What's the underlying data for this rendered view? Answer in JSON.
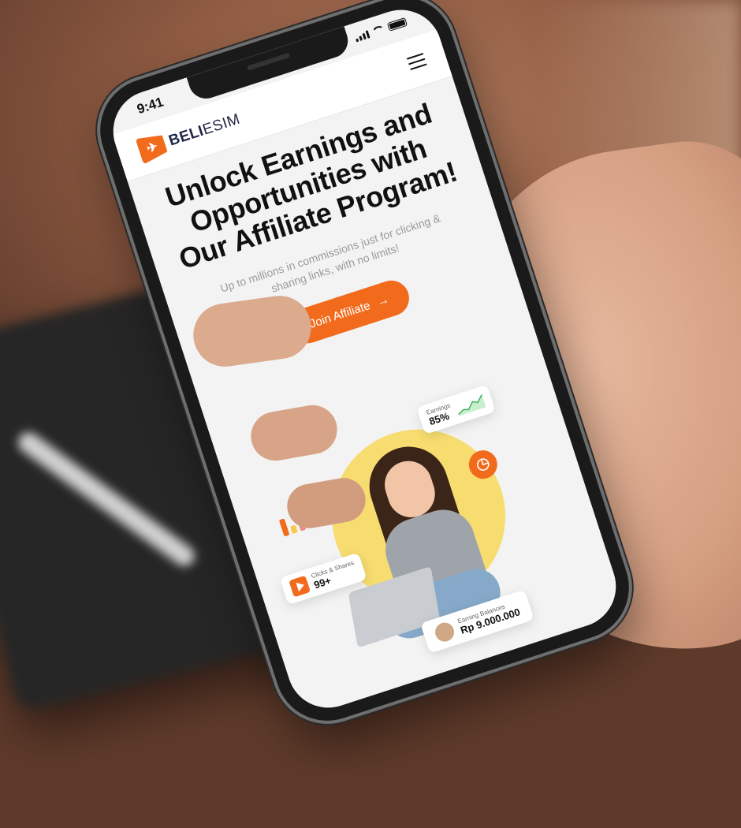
{
  "status_bar": {
    "time": "9:41"
  },
  "navbar": {
    "logo_bold": "BELI",
    "logo_light": "ESIM",
    "menu_icon": "hamburger-icon"
  },
  "hero": {
    "title": "Unlock Earnings and Opportunities with Our Affiliate Program!",
    "subtitle": "Up to millions in commissions just for clicking & sharing links, with no limits!",
    "cta_label": "Join Affiliate",
    "cta_icon": "arrow-right-icon"
  },
  "cards": {
    "earnings_label": "Earnings",
    "earnings_value": "85%",
    "clicks_label": "Clicks & Shares",
    "clicks_value": "99+",
    "balance_label": "Earning Balances",
    "balance_value": "Rp 9.000.000"
  },
  "colors": {
    "accent": "#f26b1d",
    "circle": "#f7dc6f",
    "text": "#111111",
    "muted": "#9a9a9a"
  }
}
